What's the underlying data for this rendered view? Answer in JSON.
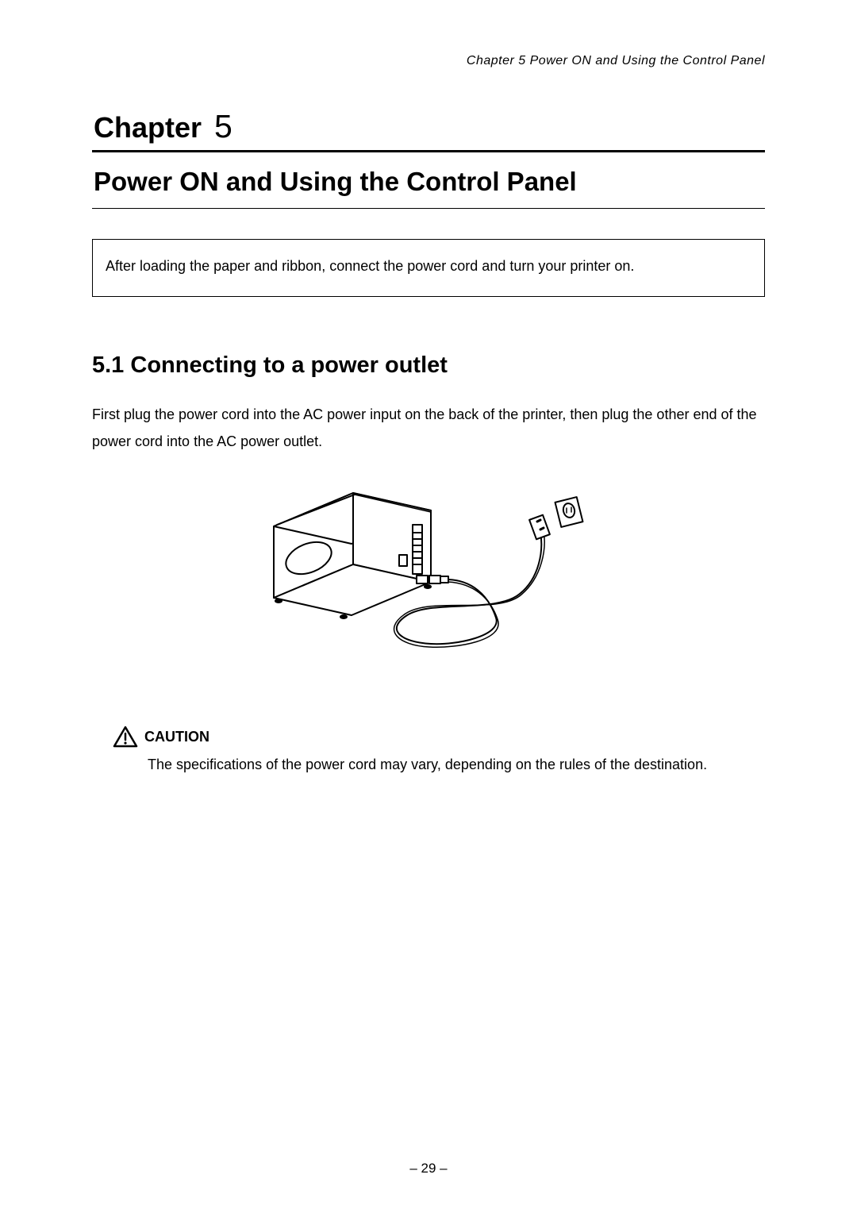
{
  "running_header": "Chapter 5   Power ON and Using the Control Panel",
  "chapter_label": "Chapter",
  "chapter_number": "5",
  "chapter_title": "Power ON and Using the Control Panel",
  "intro_box": "After loading the paper and ribbon, connect the power cord and turn your printer on.",
  "section_heading": "5.1   Connecting to a power outlet",
  "body_text": "First plug the power cord into the AC power input on the back of the printer, then plug the other end of the power cord into the AC power outlet.",
  "caution": {
    "label": "CAUTION",
    "text": "The specifications of the power cord may vary, depending on the rules of the destination."
  },
  "figure_alt": "Illustration of a printer connected to a wall power outlet via a power cord",
  "page_number": "– 29 –"
}
